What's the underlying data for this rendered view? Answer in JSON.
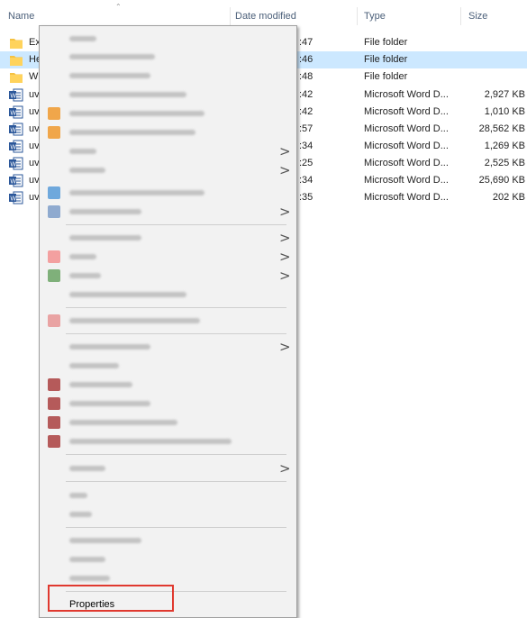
{
  "columns": {
    "name": "Name",
    "date_modified": "Date modified",
    "type": "Type",
    "size": "Size"
  },
  "files": [
    {
      "name": "Ex",
      "date": ":47",
      "type": "File folder",
      "size": "",
      "icon": "folder-icon"
    },
    {
      "name": "He",
      "date": ":46",
      "type": "File folder",
      "size": "",
      "icon": "folder-icon",
      "selected": true
    },
    {
      "name": "W",
      "date": ":48",
      "type": "File folder",
      "size": "",
      "icon": "folder-icon"
    },
    {
      "name": "uv",
      "date": ":42",
      "type": "Microsoft Word D...",
      "size": "2,927 KB",
      "icon": "word-doc-icon"
    },
    {
      "name": "uv",
      "date": ":42",
      "type": "Microsoft Word D...",
      "size": "1,010 KB",
      "icon": "word-doc-icon"
    },
    {
      "name": "uv",
      "date": ":57",
      "type": "Microsoft Word D...",
      "size": "28,562 KB",
      "icon": "word-doc-icon"
    },
    {
      "name": "uv",
      "date": ":34",
      "type": "Microsoft Word D...",
      "size": "1,269 KB",
      "icon": "word-doc-icon"
    },
    {
      "name": "uv",
      "date": ":25",
      "type": "Microsoft Word D...",
      "size": "2,525 KB",
      "icon": "word-doc-icon"
    },
    {
      "name": "uv",
      "date": ":34",
      "type": "Microsoft Word D...",
      "size": "25,690 KB",
      "icon": "word-doc-icon"
    },
    {
      "name": "uv",
      "date": ":35",
      "type": "Microsoft Word D...",
      "size": "202 KB",
      "icon": "word-doc-icon"
    }
  ],
  "context_menu": {
    "properties_label": "Properties",
    "blurred_item_count": 29,
    "highlight_color": "#e0392f"
  },
  "colors": {
    "selection": "#cce8ff",
    "folder": "#f5c242",
    "word": "#2b579a",
    "header_text": "#4c607a"
  }
}
